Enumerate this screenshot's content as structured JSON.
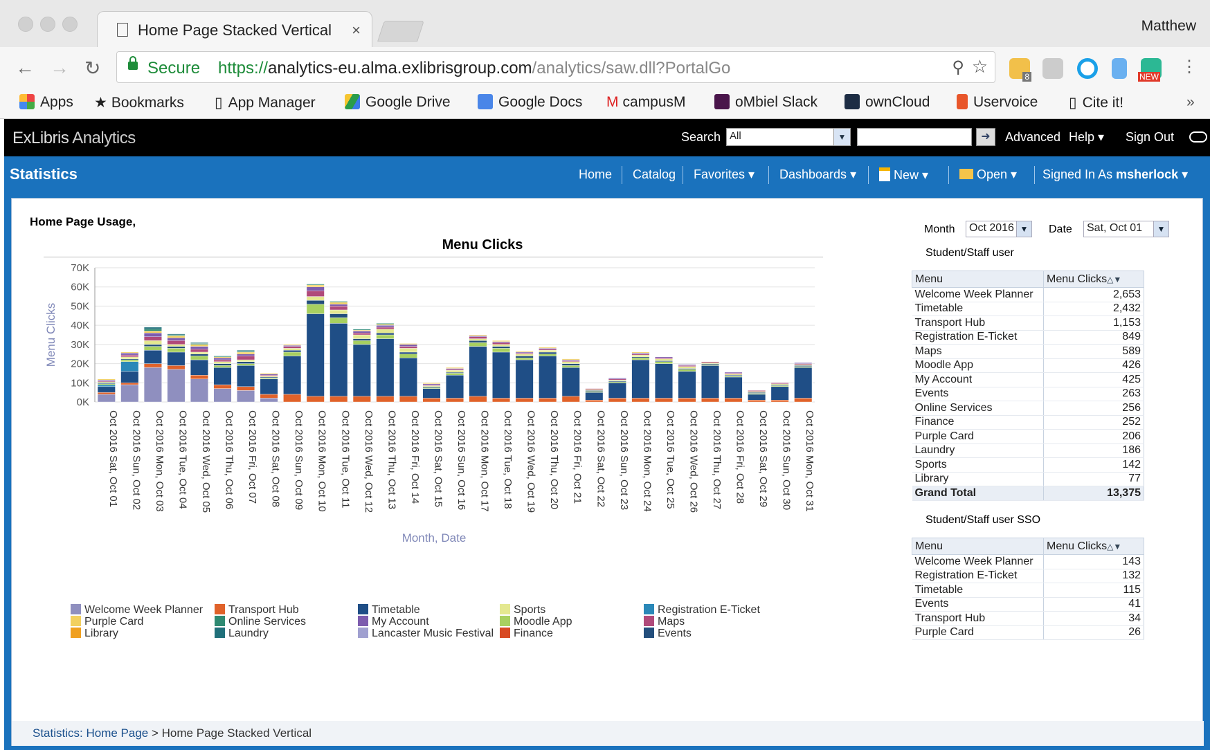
{
  "browser": {
    "tab_title": "Home Page Stacked Vertical",
    "tab_close": "×",
    "profile": "Matthew",
    "secure": "Secure",
    "url_scheme": "https://",
    "url_host": "analytics-eu.alma.exlibrisgroup.com",
    "url_path": "/analytics/saw.dll?PortalGo",
    "bookmarks": [
      "Apps",
      "Bookmarks",
      "App Manager",
      "Google Drive",
      "Google Docs",
      "campusM",
      "oMbiel Slack",
      "ownCloud",
      "Uservoice",
      "Cite it!"
    ],
    "bookmarks_more": "»",
    "extension_badge": "8",
    "extension_new": "NEW"
  },
  "app": {
    "logo_a": "ExLibris",
    "logo_b": "Analytics",
    "search_label": "Search",
    "search_scope": "All",
    "advanced": "Advanced",
    "help": "Help",
    "signout": "Sign Out",
    "section": "Statistics",
    "nav": {
      "home": "Home",
      "catalog": "Catalog",
      "favorites": "Favorites",
      "dashboards": "Dashboards",
      "new": "New",
      "open": "Open",
      "signed_in_as": "Signed In As",
      "user": "msherlock"
    }
  },
  "page": {
    "heading": "Home Page Usage,",
    "breadcrumb_link": "Statistics: Home Page",
    "breadcrumb_sep": ">",
    "breadcrumb_current": "Home Page Stacked Vertical"
  },
  "filters": {
    "month_label": "Month",
    "month_value": "Oct 2016",
    "date_label": "Date",
    "date_value": "Sat, Oct 01"
  },
  "table1": {
    "title": "Student/Staff user",
    "col_menu": "Menu",
    "col_clicks": "Menu Clicks",
    "rows": [
      [
        "Welcome Week Planner",
        "2,653"
      ],
      [
        "Timetable",
        "2,432"
      ],
      [
        "Transport Hub",
        "1,153"
      ],
      [
        "Registration E-Ticket",
        "849"
      ],
      [
        "Maps",
        "589"
      ],
      [
        "Moodle App",
        "426"
      ],
      [
        "My Account",
        "425"
      ],
      [
        "Events",
        "263"
      ],
      [
        "Online Services",
        "256"
      ],
      [
        "Finance",
        "252"
      ],
      [
        "Purple Card",
        "206"
      ],
      [
        "Laundry",
        "186"
      ],
      [
        "Sports",
        "142"
      ],
      [
        "Library",
        "77"
      ]
    ],
    "total_label": "Grand Total",
    "total_value": "13,375"
  },
  "table2": {
    "title": "Student/Staff user SSO",
    "col_menu": "Menu",
    "col_clicks": "Menu Clicks",
    "rows": [
      [
        "Welcome Week Planner",
        "143"
      ],
      [
        "Registration E-Ticket",
        "132"
      ],
      [
        "Timetable",
        "115"
      ],
      [
        "Events",
        "41"
      ],
      [
        "Transport Hub",
        "34"
      ],
      [
        "Purple Card",
        "26"
      ]
    ]
  },
  "chart_data": {
    "type": "bar",
    "stacked": true,
    "title": "Menu Clicks",
    "xlabel": "Month, Date",
    "ylabel": "Menu Clicks",
    "ylim": [
      0,
      70000
    ],
    "yticks": [
      "0K",
      "10K",
      "20K",
      "30K",
      "40K",
      "50K",
      "60K",
      "70K"
    ],
    "categories": [
      "Oct 2016 Sat, Oct 01",
      "Oct 2016 Sun, Oct 02",
      "Oct 2016 Mon, Oct 03",
      "Oct 2016 Tue, Oct 04",
      "Oct 2016 Wed, Oct 05",
      "Oct 2016 Thu, Oct 06",
      "Oct 2016 Fri, Oct 07",
      "Oct 2016 Sat, Oct 08",
      "Oct 2016 Sun, Oct 09",
      "Oct 2016 Mon, Oct 10",
      "Oct 2016 Tue, Oct 11",
      "Oct 2016 Wed, Oct 12",
      "Oct 2016 Thu, Oct 13",
      "Oct 2016 Fri, Oct 14",
      "Oct 2016 Sat, Oct 15",
      "Oct 2016 Sun, Oct 16",
      "Oct 2016 Mon, Oct 17",
      "Oct 2016 Tue, Oct 18",
      "Oct 2016 Wed, Oct 19",
      "Oct 2016 Thu, Oct 20",
      "Oct 2016 Fri, Oct 21",
      "Oct 2016 Sat, Oct 22",
      "Oct 2016 Sun, Oct 23",
      "Oct 2016 Mon, Oct 24",
      "Oct 2016 Tue, Oct 25",
      "Oct 2016 Wed, Oct 26",
      "Oct 2016 Thu, Oct 27",
      "Oct 2016 Fri, Oct 28",
      "Oct 2016 Sat, Oct 29",
      "Oct 2016 Sun, Oct 30",
      "Oct 2016 Mon, Oct 31"
    ],
    "series": [
      {
        "name": "Welcome Week Planner",
        "color": "#8f8fbf",
        "values": [
          4000,
          9000,
          18000,
          17000,
          12000,
          7000,
          6000,
          2000,
          0,
          0,
          0,
          0,
          0,
          0,
          0,
          0,
          0,
          0,
          0,
          0,
          0,
          0,
          0,
          0,
          0,
          0,
          0,
          0,
          0,
          0,
          0
        ]
      },
      {
        "name": "Transport Hub",
        "color": "#e0622a",
        "values": [
          1000,
          1000,
          2000,
          2000,
          2000,
          2000,
          2000,
          2000,
          4000,
          3000,
          3000,
          3000,
          3000,
          3000,
          2000,
          2000,
          3000,
          2000,
          2000,
          2000,
          3000,
          1000,
          2000,
          2000,
          2000,
          2000,
          2000,
          2000,
          1000,
          1000,
          2000
        ]
      },
      {
        "name": "Timetable",
        "color": "#1f4e86",
        "values": [
          3000,
          6000,
          7000,
          7000,
          8000,
          9000,
          11000,
          8000,
          20000,
          43000,
          38000,
          27000,
          30000,
          20000,
          5000,
          12000,
          26000,
          24000,
          20000,
          22000,
          15000,
          4000,
          8000,
          20000,
          18000,
          14000,
          17000,
          11000,
          3000,
          7000,
          16000
        ]
      },
      {
        "name": "Registration E-Ticket",
        "color": "#2a88b8",
        "values": [
          1000,
          5000,
          0,
          0,
          0,
          0,
          0,
          0,
          0,
          0,
          0,
          0,
          0,
          0,
          0,
          0,
          0,
          0,
          0,
          0,
          0,
          0,
          0,
          0,
          0,
          0,
          0,
          0,
          0,
          0,
          0
        ]
      },
      {
        "name": "Moodle App",
        "color": "#a8d060",
        "values": [
          500,
          1000,
          2000,
          2000,
          2000,
          1000,
          1000,
          500,
          2000,
          5000,
          3000,
          2000,
          2000,
          2000,
          500,
          1000,
          2000,
          2000,
          1000,
          1000,
          1000,
          500,
          500,
          1000,
          1000,
          1000,
          500,
          500,
          500,
          500,
          500
        ]
      },
      {
        "name": "Events",
        "color": "#234e7c",
        "values": [
          500,
          500,
          1000,
          1000,
          1000,
          1000,
          1000,
          500,
          1000,
          2000,
          2000,
          1000,
          1000,
          1000,
          500,
          500,
          1000,
          1000,
          1000,
          1000,
          1000,
          500,
          500,
          500,
          500,
          500,
          500,
          500,
          500,
          500,
          500
        ]
      },
      {
        "name": "Sports",
        "color": "#e4e890",
        "values": [
          500,
          1000,
          2000,
          1000,
          1000,
          1000,
          1000,
          500,
          1000,
          2000,
          2000,
          2000,
          2000,
          2000,
          500,
          1000,
          1000,
          1000,
          1000,
          1000,
          1000,
          500,
          500,
          1000,
          1000,
          1000,
          500,
          500,
          500,
          500,
          500
        ]
      },
      {
        "name": "Maps",
        "color": "#b04a7a",
        "values": [
          500,
          1000,
          2000,
          2000,
          1500,
          1000,
          2000,
          500,
          1000,
          3000,
          2000,
          1000,
          1000,
          1000,
          500,
          500,
          1000,
          1000,
          500,
          500,
          500,
          500,
          500,
          500,
          500,
          500,
          500,
          500,
          500,
          500,
          500
        ]
      },
      {
        "name": "My Account",
        "color": "#7d5cae",
        "values": [
          500,
          1000,
          2000,
          1500,
          1500,
          1000,
          1000,
          500,
          500,
          2000,
          1000,
          1000,
          1000,
          1000,
          500,
          500,
          500,
          500,
          500,
          500,
          500,
          0,
          500,
          500,
          500,
          500,
          0,
          500,
          0,
          0,
          500
        ]
      },
      {
        "name": "Purple Card",
        "color": "#f2d060",
        "values": [
          500,
          500,
          1000,
          1000,
          1000,
          500,
          1000,
          500,
          500,
          1000,
          1000,
          500,
          500,
          500,
          500,
          500,
          500,
          500,
          500,
          500,
          500,
          0,
          0,
          500,
          0,
          0,
          0,
          0,
          0,
          0,
          0
        ]
      },
      {
        "name": "Online Services",
        "color": "#2e8a72",
        "values": [
          0,
          0,
          1000,
          500,
          500,
          500,
          500,
          0,
          0,
          500,
          500,
          500,
          500,
          0,
          0,
          0,
          0,
          0,
          0,
          0,
          0,
          0,
          0,
          0,
          0,
          0,
          0,
          0,
          0,
          0,
          0
        ]
      },
      {
        "name": "Laundry",
        "color": "#20707a",
        "values": [
          0,
          0,
          1000,
          500,
          500,
          0,
          500,
          0,
          0,
          0,
          0,
          0,
          0,
          0,
          0,
          0,
          0,
          0,
          0,
          0,
          0,
          0,
          0,
          0,
          0,
          0,
          0,
          0,
          0,
          0,
          0
        ]
      },
      {
        "name": "Lancaster Music Festival",
        "color": "#a0a0d0",
        "values": [
          0,
          0,
          0,
          0,
          0,
          0,
          0,
          0,
          0,
          0,
          0,
          0,
          0,
          0,
          0,
          0,
          0,
          0,
          0,
          0,
          0,
          0,
          0,
          0,
          0,
          0,
          0,
          0,
          0,
          0,
          0
        ]
      },
      {
        "name": "Finance",
        "color": "#d84a24",
        "values": [
          0,
          0,
          0,
          0,
          0,
          0,
          0,
          0,
          0,
          0,
          0,
          0,
          0,
          0,
          0,
          0,
          0,
          0,
          0,
          0,
          0,
          0,
          0,
          0,
          0,
          0,
          0,
          0,
          0,
          0,
          0
        ]
      },
      {
        "name": "Library",
        "color": "#f0a020",
        "values": [
          0,
          0,
          0,
          0,
          0,
          0,
          0,
          0,
          0,
          0,
          0,
          0,
          0,
          0,
          0,
          0,
          0,
          0,
          0,
          0,
          0,
          0,
          0,
          0,
          0,
          0,
          0,
          0,
          0,
          0,
          0
        ]
      }
    ],
    "legend": [
      [
        "Welcome Week Planner",
        "Transport Hub",
        "Timetable",
        "Sports",
        "Registration E-Ticket"
      ],
      [
        "Purple Card",
        "Online Services",
        "My Account",
        "Moodle App",
        "Maps"
      ],
      [
        "Library",
        "Laundry",
        "Lancaster Music Festival",
        "Finance",
        "Events"
      ]
    ],
    "legend_position": "bottom",
    "grid": true
  }
}
